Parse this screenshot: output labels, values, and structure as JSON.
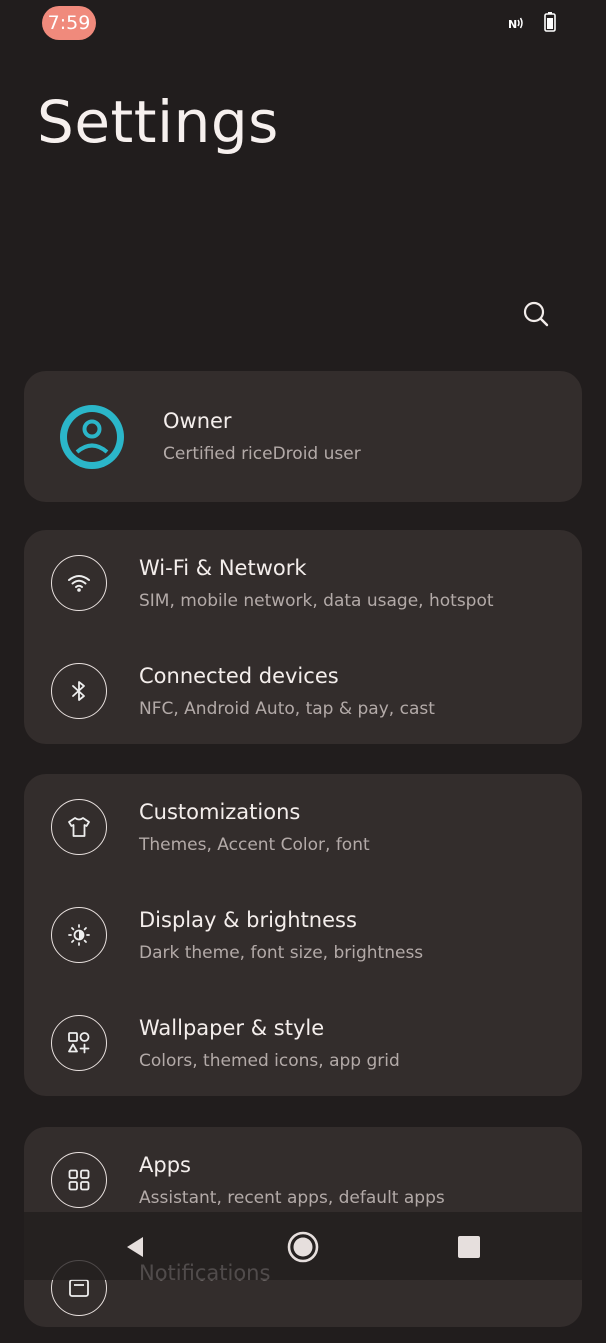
{
  "status_bar": {
    "time": "7:59",
    "icons": [
      "nfc-icon",
      "battery-icon"
    ]
  },
  "header": {
    "title": "Settings",
    "search_icon": "search-icon"
  },
  "owner": {
    "name": "Owner",
    "subtitle": "Certified riceDroid user",
    "avatar_icon": "account-circle-icon",
    "avatar_color": "#2bb6c9"
  },
  "groups": [
    {
      "items": [
        {
          "icon": "wifi-icon",
          "title": "Wi-Fi & Network",
          "subtitle": "SIM, mobile network, data usage, hotspot"
        },
        {
          "icon": "bluetooth-icon",
          "title": "Connected devices",
          "subtitle": "NFC, Android Auto, tap & pay, cast"
        }
      ]
    },
    {
      "items": [
        {
          "icon": "tshirt-icon",
          "title": "Customizations",
          "subtitle": "Themes, Accent Color, font"
        },
        {
          "icon": "brightness-icon",
          "title": "Display & brightness",
          "subtitle": "Dark theme, font size, brightness"
        },
        {
          "icon": "wallpaper-shapes-icon",
          "title": "Wallpaper & style",
          "subtitle": "Colors, themed icons, app grid"
        }
      ]
    },
    {
      "items": [
        {
          "icon": "apps-grid-icon",
          "title": "Apps",
          "subtitle": "Assistant, recent apps, default apps"
        },
        {
          "icon": "notifications-icon",
          "title": "Notifications",
          "subtitle": ""
        }
      ]
    }
  ],
  "nav_bar": {
    "buttons": [
      "back-icon",
      "home-icon",
      "recents-icon"
    ]
  },
  "colors": {
    "background": "#211d1d",
    "card": "#332d2c",
    "time_pill": "#f08a7c",
    "text_primary": "#f4eeec",
    "text_secondary": "#b3aaa8"
  }
}
